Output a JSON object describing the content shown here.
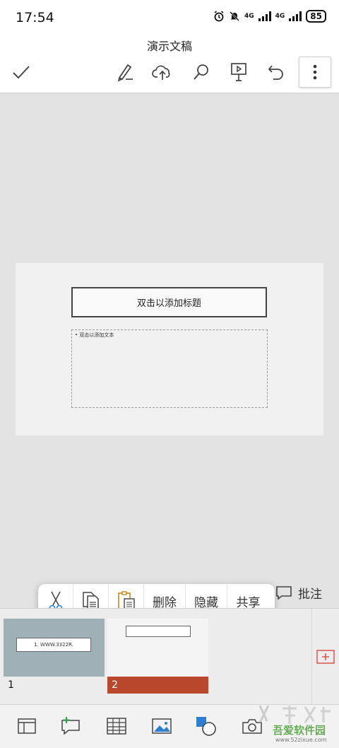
{
  "status_bar": {
    "time": "17:54",
    "signal1": "4G",
    "signal2": "4G",
    "battery": "85"
  },
  "header": {
    "title": "演示文稿",
    "icons": [
      "check-icon",
      "pen-icon",
      "cloud-upload-icon",
      "search-icon",
      "present-icon",
      "undo-icon",
      "more-icon"
    ]
  },
  "slide": {
    "title_placeholder": "双击以添加标题",
    "content_placeholder": "• 双击以添加文本"
  },
  "context_menu": {
    "cut_icon": "scissors-icon",
    "copy_icon": "copy-icon",
    "paste_icon": "paste-icon",
    "delete_label": "删除",
    "hide_label": "隐藏",
    "share_label": "共享"
  },
  "comment": {
    "label": "批注"
  },
  "thumbnails": [
    {
      "number": "1",
      "text": "1.  WWW.3322R."
    },
    {
      "number": "2"
    }
  ],
  "bottom_toolbar": {
    "icons": [
      "layout-icon",
      "new-comment-icon",
      "table-icon",
      "image-icon",
      "shapes-icon",
      "camera-icon"
    ]
  },
  "watermark": {
    "text": "吾爱软件园",
    "url": "www.52zixue.com"
  },
  "colors": {
    "accent": "#b9472c",
    "add_icon": "#d9534f",
    "icon_blue": "#2d7fd1"
  }
}
